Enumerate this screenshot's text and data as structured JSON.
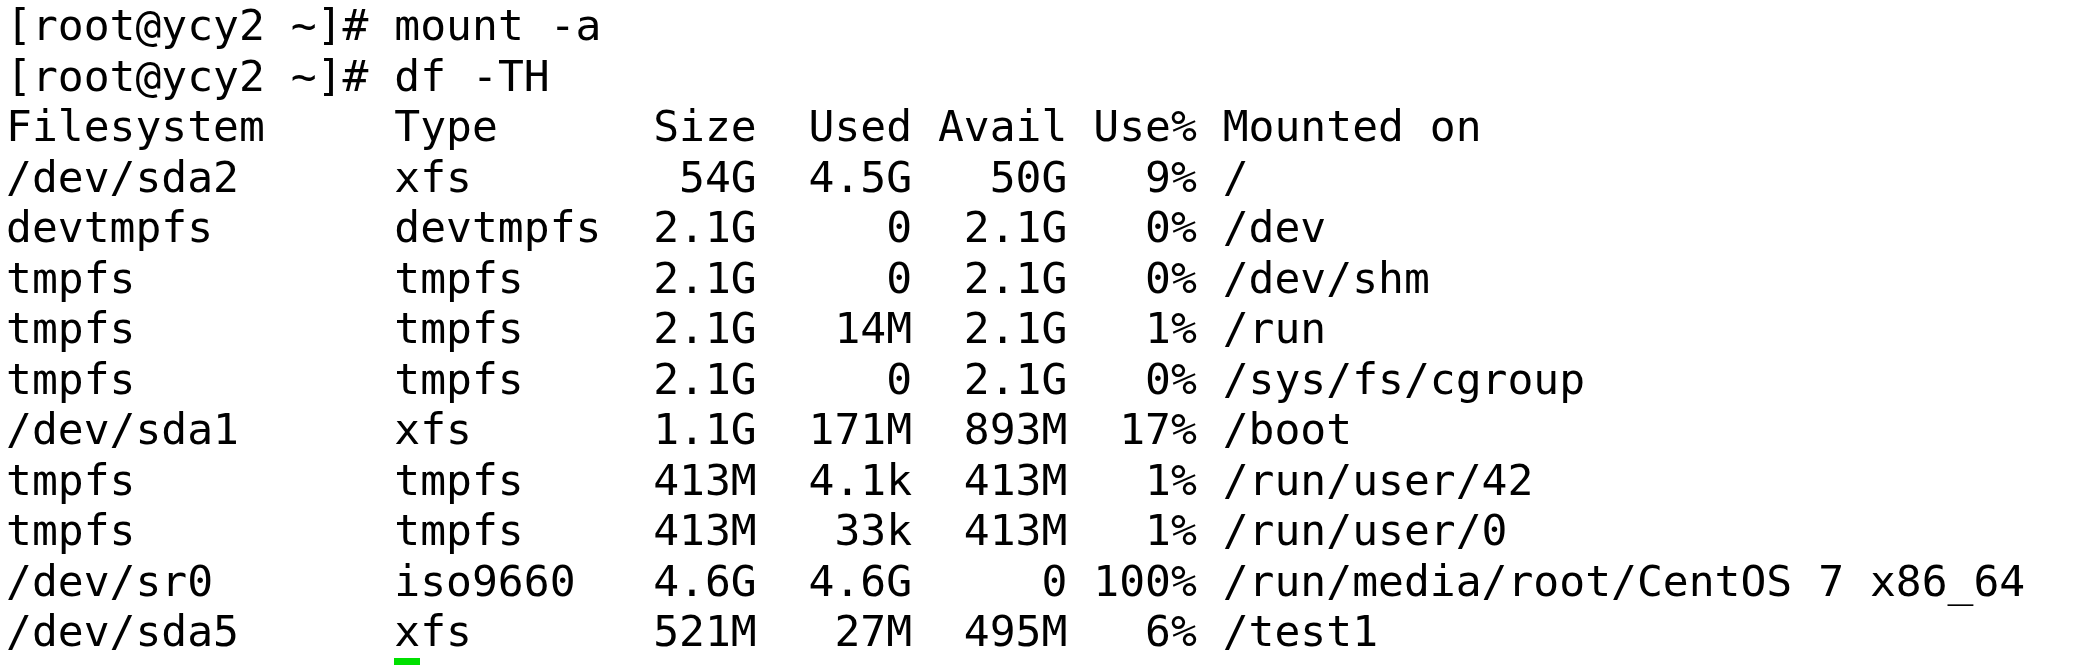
{
  "commands": [
    {
      "prompt": "[root@ycy2 ~]#",
      "command": "mount -a"
    },
    {
      "prompt": "[root@ycy2 ~]#",
      "command": "df -TH"
    }
  ],
  "table": {
    "columns": [
      "Filesystem",
      "Type",
      "Size",
      "Used",
      "Avail",
      "Use%",
      "Mounted on"
    ],
    "rows": [
      {
        "cells": [
          "/dev/sda2",
          "xfs",
          "54G",
          "4.5G",
          "50G",
          "9%",
          "/"
        ],
        "cursor": false
      },
      {
        "cells": [
          "devtmpfs",
          "devtmpfs",
          "2.1G",
          "0",
          "2.1G",
          "0%",
          "/dev"
        ],
        "cursor": false
      },
      {
        "cells": [
          "tmpfs",
          "tmpfs",
          "2.1G",
          "0",
          "2.1G",
          "0%",
          "/dev/shm"
        ],
        "cursor": false
      },
      {
        "cells": [
          "tmpfs",
          "tmpfs",
          "2.1G",
          "14M",
          "2.1G",
          "1%",
          "/run"
        ],
        "cursor": false
      },
      {
        "cells": [
          "tmpfs",
          "tmpfs",
          "2.1G",
          "0",
          "2.1G",
          "0%",
          "/sys/fs/cgroup"
        ],
        "cursor": false
      },
      {
        "cells": [
          "/dev/sda1",
          "xfs",
          "1.1G",
          "171M",
          "893M",
          "17%",
          "/boot"
        ],
        "cursor": false
      },
      {
        "cells": [
          "tmpfs",
          "tmpfs",
          "413M",
          "4.1k",
          "413M",
          "1%",
          "/run/user/42"
        ],
        "cursor": false
      },
      {
        "cells": [
          "tmpfs",
          "tmpfs",
          "413M",
          "33k",
          "413M",
          "1%",
          "/run/user/0"
        ],
        "cursor": false
      },
      {
        "cells": [
          "/dev/sr0",
          "iso9660",
          "4.6G",
          "4.6G",
          "0",
          "100%",
          "/run/media/root/CentOS 7 x86_64"
        ],
        "cursor": false
      },
      {
        "cells": [
          "/dev/sda5",
          "xfs",
          "521M",
          "27M",
          "495M",
          "6%",
          "/test1"
        ],
        "cursor": true
      }
    ]
  }
}
